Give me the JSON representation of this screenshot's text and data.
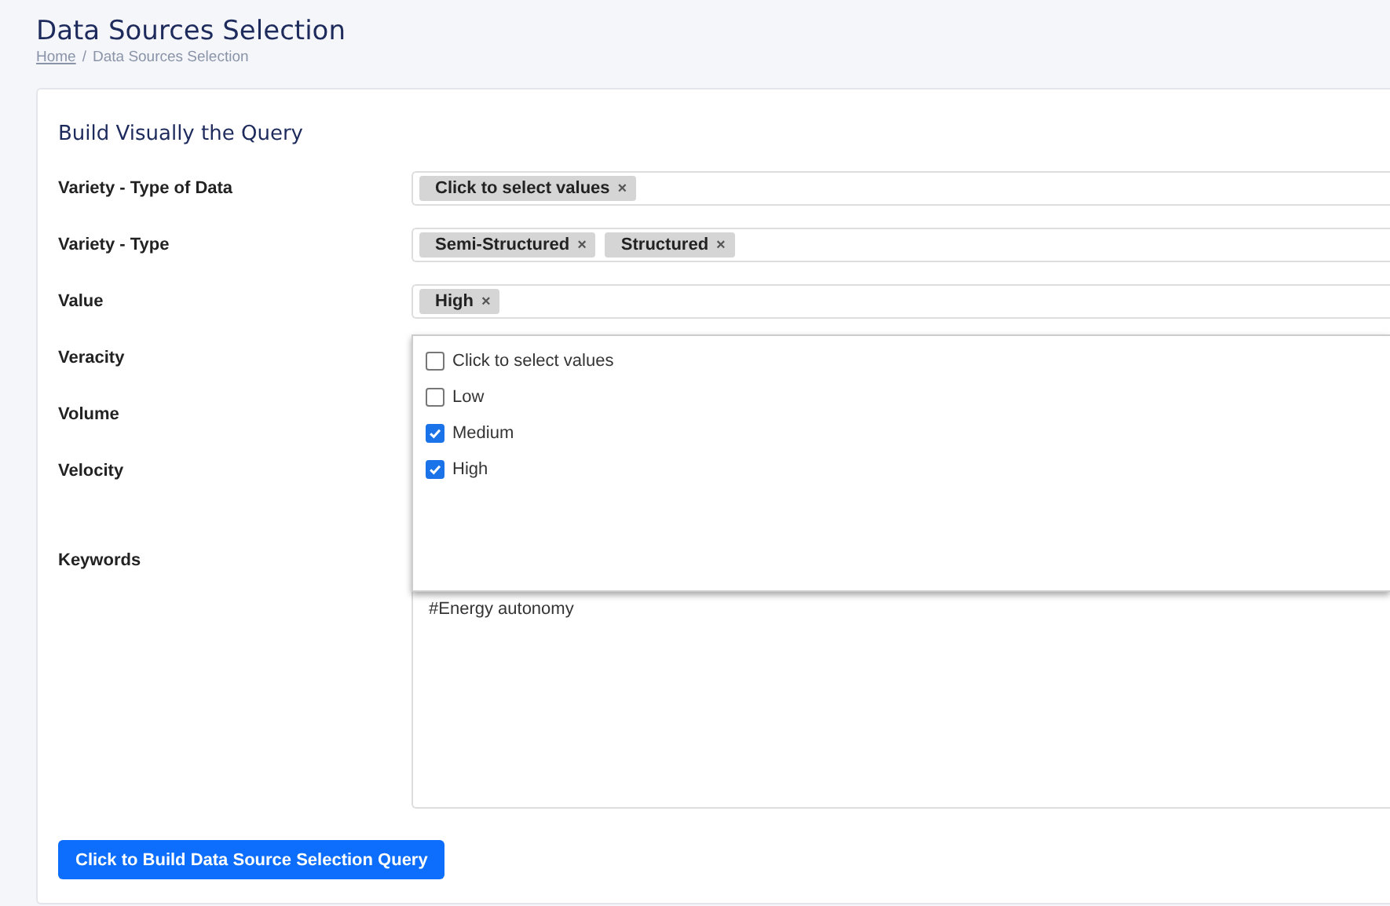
{
  "page": {
    "title": "Data Sources Selection",
    "breadcrumb": [
      {
        "label": "Home",
        "kind": "link"
      },
      {
        "label": "/",
        "kind": "separator"
      },
      {
        "label": "Data Sources Selection",
        "kind": "current"
      }
    ]
  },
  "form": {
    "heading": "Build Visually the Query",
    "fields": [
      {
        "label": "Variety - Type of Data",
        "kind": "tags",
        "tags": [
          {
            "label": "Click to select values",
            "remove": "×"
          }
        ]
      },
      {
        "label": "Variety - Type",
        "kind": "tags",
        "tags": [
          {
            "label": "Semi-Structured",
            "remove": "×"
          },
          {
            "label": "Structured",
            "remove": "×"
          }
        ]
      },
      {
        "label": "Value",
        "kind": "tags",
        "tags": [
          {
            "label": "High",
            "remove": "×"
          }
        ]
      },
      {
        "label": "Veracity",
        "kind": "dropdown",
        "options": [
          {
            "label": "Click to select values",
            "checked": false
          },
          {
            "label": "Low",
            "checked": false
          },
          {
            "label": "Medium",
            "checked": true
          },
          {
            "label": "High",
            "checked": true
          }
        ]
      },
      {
        "label": "Volume",
        "kind": "covered"
      },
      {
        "label": "Velocity",
        "kind": "covered"
      },
      {
        "label": "Keywords",
        "kind": "textarea",
        "value": "#Energy autonomy"
      }
    ],
    "submit": "Click to Build Data Source Selection Query"
  }
}
